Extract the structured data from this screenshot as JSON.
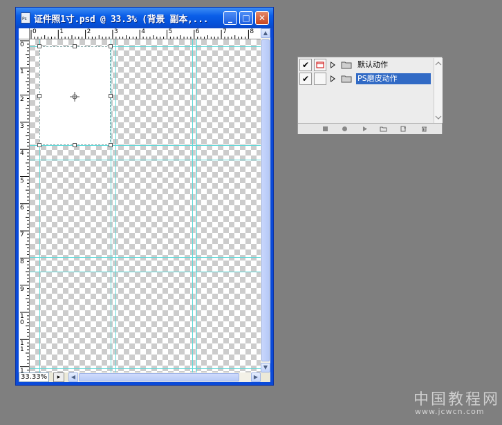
{
  "document": {
    "title": "证件照1寸.psd @ 33.3% (背景 副本,...",
    "icon_label": "Ps",
    "zoom": "33.33%",
    "ruler_top_numbers": [
      "0",
      "1",
      "2",
      "3",
      "4",
      "5",
      "6",
      "7",
      "8"
    ],
    "ruler_left_numbers": [
      "0",
      "1",
      "2",
      "3",
      "4",
      "5",
      "6",
      "7",
      "8",
      "9",
      "1\n0",
      "1\n1",
      "1\n2"
    ],
    "window_controls": {
      "minimize": "minimize-icon",
      "maximize": "maximize-icon",
      "close": "close-icon"
    }
  },
  "actions_panel": {
    "items": [
      {
        "label": "默认动作",
        "checked": true,
        "selected": false
      },
      {
        "label": "PS磨皮动作",
        "checked": true,
        "selected": true
      }
    ],
    "toolbar": [
      "stop-icon",
      "record-icon",
      "play-icon",
      "new-set-icon",
      "new-action-icon",
      "delete-icon"
    ]
  },
  "watermark": {
    "main": "中国教程网",
    "sub": "www.jcwcn.com"
  },
  "colors": {
    "selected": "#316ac5",
    "guide": "#5fd8d8",
    "titlebar": "#0a5ee8"
  }
}
